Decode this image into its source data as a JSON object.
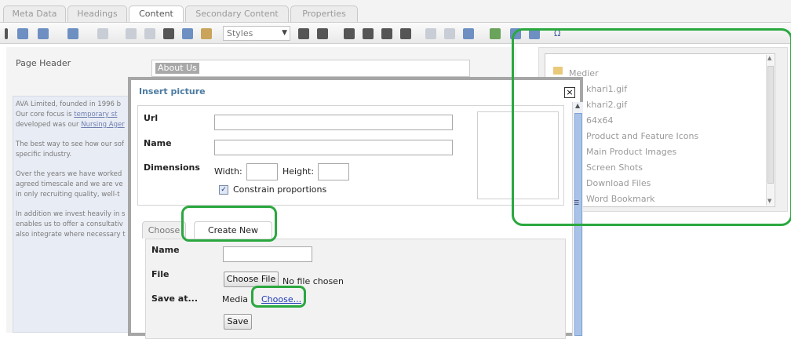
{
  "tabs": [
    "Meta Data",
    "Headings",
    "Content",
    "Secondary Content",
    "Properties"
  ],
  "toolbar": {
    "styles_label": "Styles"
  },
  "editor": {
    "page_header_label": "Page Header",
    "page_header_value": "About Us",
    "body_paragraphs": [
      [
        "AVA Limited, founded in 1996 b",
        "Our core focus is ",
        "temporary st",
        "developed was our ",
        "Nursing Ager"
      ],
      [
        "The best way to see how our sof",
        "specific industry."
      ],
      [
        "Over the years we have worked",
        "agreed timescale and we are ve",
        "in only recruiting quality, well-t"
      ],
      [
        "In addition we invest heavily in s",
        "enables us to offer a consultativ",
        "also integrate where necessary t"
      ]
    ]
  },
  "media": {
    "items": [
      "Medier",
      "khari1.gif",
      "khari2.gif",
      "64x64",
      "Product and Feature Icons",
      "Main Product Images",
      "Screen Shots",
      "Download Files",
      "Word Bookmark"
    ]
  },
  "dialog": {
    "title": "Insert picture",
    "close": "×",
    "url_label": "Url",
    "name_label": "Name",
    "dimensions_label": "Dimensions",
    "width_label": "Width:",
    "height_label": "Height:",
    "constrain_label": "Constrain proportions",
    "constrain_checked": true,
    "tab_choose": "Choose",
    "tab_create_new": "Create New",
    "create": {
      "name_label": "Name",
      "file_label": "File",
      "choose_file_button": "Choose File",
      "no_file_text": "No file chosen",
      "save_at_label": "Save at...",
      "media_text": "Media",
      "choose_link": "Choose...",
      "save_button": "Save"
    }
  },
  "colors": {
    "annotation": "#2aa83f",
    "dialog_title": "#4b7aa0",
    "link": "#1c3ab8"
  }
}
